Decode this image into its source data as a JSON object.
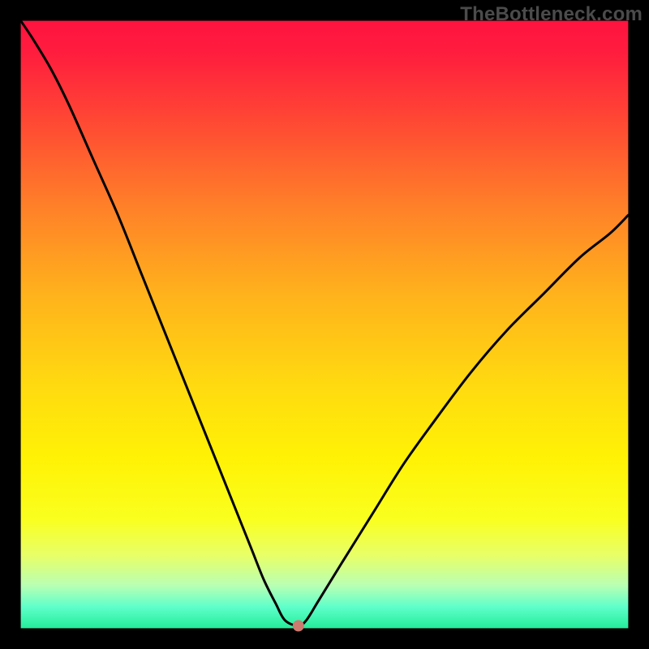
{
  "watermark": "TheBottleneck.com",
  "chart_data": {
    "type": "line",
    "title": "",
    "xlabel": "",
    "ylabel": "",
    "xlim": [
      0,
      100
    ],
    "ylim": [
      0,
      100
    ],
    "grid": false,
    "legend": false,
    "background": {
      "type": "vertical-gradient",
      "stops": [
        {
          "offset": 0.0,
          "color": "#ff1340"
        },
        {
          "offset": 0.05,
          "color": "#ff1c3e"
        },
        {
          "offset": 0.15,
          "color": "#ff4235"
        },
        {
          "offset": 0.3,
          "color": "#ff7e29"
        },
        {
          "offset": 0.45,
          "color": "#ffb21c"
        },
        {
          "offset": 0.6,
          "color": "#ffda10"
        },
        {
          "offset": 0.72,
          "color": "#fff205"
        },
        {
          "offset": 0.82,
          "color": "#faff1e"
        },
        {
          "offset": 0.88,
          "color": "#e8ff68"
        },
        {
          "offset": 0.93,
          "color": "#b8ffb4"
        },
        {
          "offset": 0.965,
          "color": "#5effca"
        },
        {
          "offset": 1.0,
          "color": "#24ed9a"
        }
      ]
    },
    "series": [
      {
        "name": "bottleneck-curve",
        "color": "#000000",
        "stroke_width": 3,
        "x": [
          0,
          2,
          5,
          8,
          12,
          16,
          20,
          24,
          28,
          32,
          36,
          38,
          40,
          42,
          43.5,
          45.7,
          47,
          49,
          53,
          58,
          63,
          68,
          74,
          80,
          86,
          92,
          97,
          100
        ],
        "y": [
          100,
          97,
          92,
          86,
          77,
          68,
          58,
          48,
          38,
          28,
          18,
          13,
          8,
          4,
          1.3,
          0.4,
          1.3,
          4.5,
          11,
          19,
          27,
          34,
          42,
          49,
          55,
          61,
          65,
          68
        ]
      }
    ],
    "marker": {
      "name": "optimal-point",
      "x": 45.7,
      "y": 0.4,
      "color": "#cd7a6f",
      "radius": 7
    },
    "inner_box": {
      "x0": 3.2,
      "y0": 3.2,
      "x1": 96.8,
      "y1": 96.8
    }
  }
}
